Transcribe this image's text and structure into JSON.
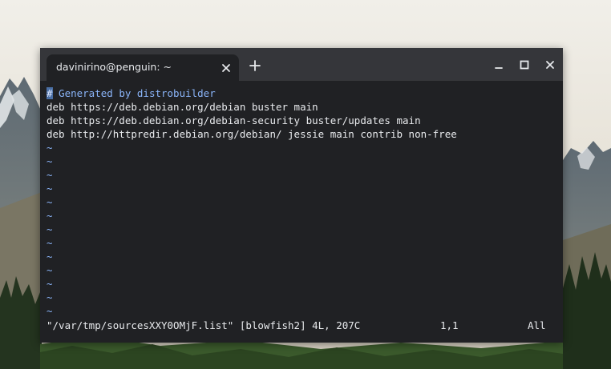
{
  "window": {
    "tab_title": "davinirino@penguin: ~"
  },
  "terminal": {
    "cursor_char": "#",
    "comment_rest": " Generated by distrobuilder",
    "lines": [
      "deb https://deb.debian.org/debian buster main",
      "deb https://deb.debian.org/debian-security buster/updates main",
      "deb http://httpredir.debian.org/debian/ jessie main contrib non-free"
    ],
    "empty_line_marker": "~",
    "status": {
      "file_info": "\"/var/tmp/sourcesXXY0OMjF.list\" [blowfish2] 4L, 207C",
      "position": "1,1",
      "scroll": "All"
    }
  },
  "colors": {
    "terminal_bg": "#202124",
    "titlebar_bg": "#35363a",
    "text": "#e8eaed",
    "comment": "#8ab4f8"
  }
}
